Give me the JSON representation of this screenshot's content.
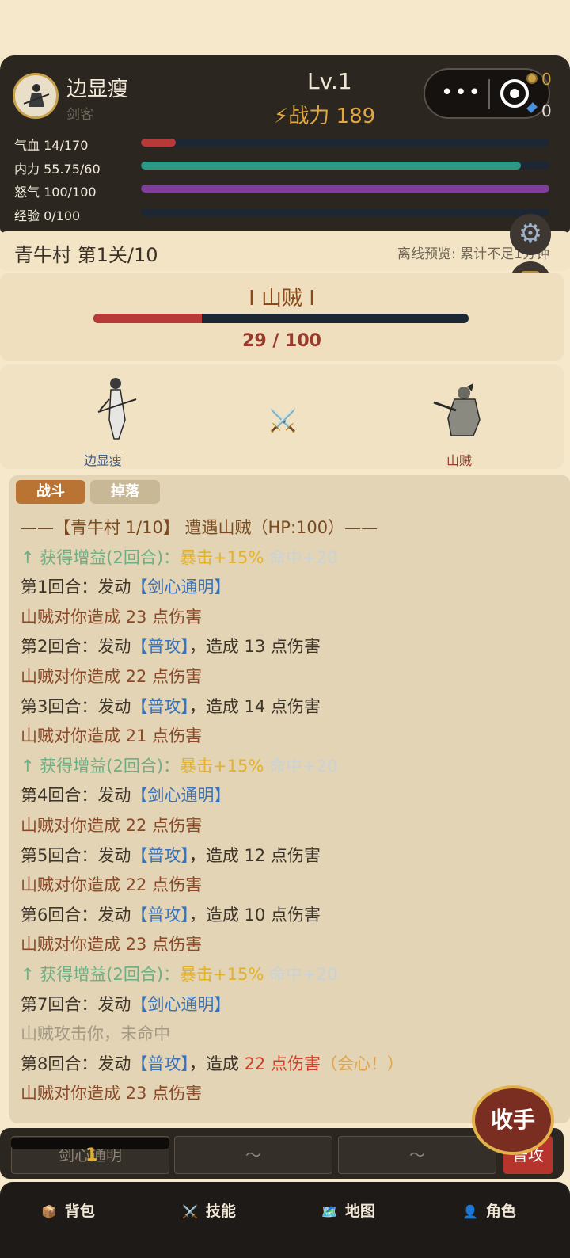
{
  "player": {
    "name": "边显瘦",
    "role": "剑客",
    "level": "Lv.1",
    "power": "⚡战力 189",
    "coins": "0",
    "gems": "0"
  },
  "stats": [
    {
      "label": "气血 14/170",
      "fill": 0.085,
      "color": "#b73a38"
    },
    {
      "label": "内力 55.75/60",
      "fill": 0.93,
      "color": "#2a9a86"
    },
    {
      "label": "怒气 100/100",
      "fill": 1.0,
      "color": "#7e3e9a"
    },
    {
      "label": "经验 0/100",
      "fill": 0.0,
      "color": "#2e6a9a"
    }
  ],
  "stage": {
    "name": "青牛村  第1关/10",
    "offline": "离线预览: 累计不足1分钟"
  },
  "enemy": {
    "title": "Ⅰ 山贼 Ⅰ",
    "hp_fill": 0.29,
    "hp_text": "29 / 100",
    "name": "山贼"
  },
  "arena": {
    "player_name": "边显瘦",
    "enemy_name": "山贼",
    "vs": "⚔️"
  },
  "tabs": {
    "fight": "战斗",
    "drop": "掉落"
  },
  "log": [
    [
      {
        "t": "——【青牛村 1/10】 遭遇山贼（HP:100）——",
        "c": "c-header"
      }
    ],
    [
      {
        "t": "  ↑ 获得增益(2回合)：",
        "c": "c-green"
      },
      {
        "t": "暴击+15%",
        "c": "c-gold"
      },
      {
        "t": " 命中+20",
        "c": "c-pale"
      }
    ],
    [
      {
        "t": "第1回合：发动",
        "c": "c-dark"
      },
      {
        "t": "【剑心通明】",
        "c": "c-blue"
      }
    ],
    [
      {
        "t": "山贼对你造成 23 点伤害",
        "c": "c-brown"
      }
    ],
    [
      {
        "t": "第2回合：发动",
        "c": "c-dark"
      },
      {
        "t": "【普攻】",
        "c": "c-blue"
      },
      {
        "t": "，造成 13 点伤害",
        "c": "c-dark"
      }
    ],
    [
      {
        "t": "山贼对你造成 22 点伤害",
        "c": "c-brown"
      }
    ],
    [
      {
        "t": "第3回合：发动",
        "c": "c-dark"
      },
      {
        "t": "【普攻】",
        "c": "c-blue"
      },
      {
        "t": "，造成 14 点伤害",
        "c": "c-dark"
      }
    ],
    [
      {
        "t": "山贼对你造成 21 点伤害",
        "c": "c-brown"
      }
    ],
    [
      {
        "t": "  ↑ 获得增益(2回合)：",
        "c": "c-green"
      },
      {
        "t": "暴击+15%",
        "c": "c-gold"
      },
      {
        "t": " 命中+20",
        "c": "c-pale"
      }
    ],
    [
      {
        "t": "第4回合：发动",
        "c": "c-dark"
      },
      {
        "t": "【剑心通明】",
        "c": "c-blue"
      }
    ],
    [
      {
        "t": "山贼对你造成 22 点伤害",
        "c": "c-brown"
      }
    ],
    [
      {
        "t": "第5回合：发动",
        "c": "c-dark"
      },
      {
        "t": "【普攻】",
        "c": "c-blue"
      },
      {
        "t": "，造成 12 点伤害",
        "c": "c-dark"
      }
    ],
    [
      {
        "t": "山贼对你造成 22 点伤害",
        "c": "c-brown"
      }
    ],
    [
      {
        "t": "第6回合：发动",
        "c": "c-dark"
      },
      {
        "t": "【普攻】",
        "c": "c-blue"
      },
      {
        "t": "，造成 10 点伤害",
        "c": "c-dark"
      }
    ],
    [
      {
        "t": "山贼对你造成 23 点伤害",
        "c": "c-brown"
      }
    ],
    [
      {
        "t": "  ↑ 获得增益(2回合)：",
        "c": "c-green"
      },
      {
        "t": "暴击+15%",
        "c": "c-gold"
      },
      {
        "t": " 命中+20",
        "c": "c-pale"
      }
    ],
    [
      {
        "t": "第7回合：发动",
        "c": "c-dark"
      },
      {
        "t": "【剑心通明】",
        "c": "c-blue"
      }
    ],
    [
      {
        "t": "山贼攻击你，未命中",
        "c": "c-grey"
      }
    ],
    [
      {
        "t": "第8回合：发动",
        "c": "c-dark"
      },
      {
        "t": "【普攻】",
        "c": "c-blue"
      },
      {
        "t": "，造成 ",
        "c": "c-dark"
      },
      {
        "t": "22 点伤害",
        "c": "c-red"
      },
      {
        "t": "（会心！）",
        "c": "c-orange"
      }
    ],
    [
      {
        "t": "山贼对你造成 23 点伤害",
        "c": "c-brown"
      }
    ]
  ],
  "skills": {
    "slot1": "剑心通明",
    "slot1_cd": "1",
    "slot2": "～",
    "slot3": "～",
    "attack": "普攻"
  },
  "withdraw": "收手",
  "nav": [
    {
      "label": "背包",
      "icon": "📦"
    },
    {
      "label": "技能",
      "icon": "⚔️"
    },
    {
      "label": "地图",
      "icon": "🗺️"
    },
    {
      "label": "角色",
      "icon": "👤"
    }
  ]
}
